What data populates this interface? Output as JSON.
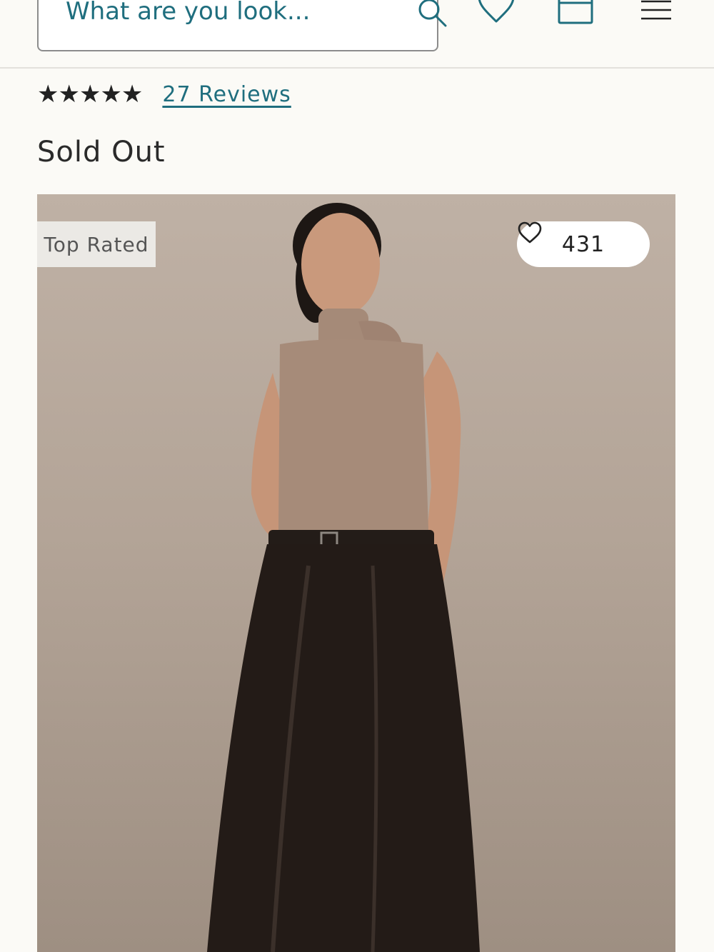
{
  "header": {
    "search": {
      "placeholder": "What are you look..."
    },
    "icons": [
      "search-icon",
      "heart-icon",
      "bag-icon",
      "menu-icon"
    ]
  },
  "product": {
    "rating": {
      "stars_text": "★★★★★",
      "stars_value": 5,
      "reviews_label": "27 Reviews"
    },
    "status": "Sold Out",
    "image": {
      "badge": "Top Rated",
      "likes": "431",
      "like_icon": "heart-outline-icon"
    }
  },
  "colors": {
    "accent": "#1f6e7e",
    "background": "#fbfaf6",
    "text": "#222222"
  }
}
